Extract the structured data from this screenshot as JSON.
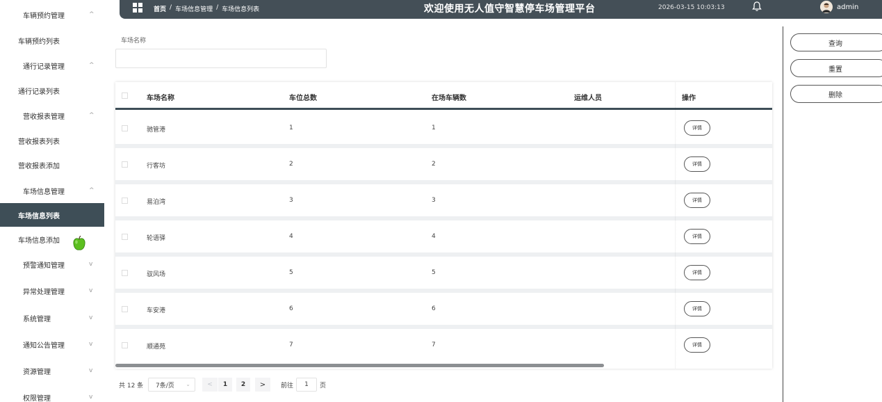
{
  "sidebar": {
    "groups": [
      {
        "label": "车辆预约管理",
        "chevron": "^"
      },
      {
        "label": "通行记录管理",
        "chevron": "^"
      },
      {
        "label": "营收报表管理",
        "chevron": "^"
      },
      {
        "label": "车场信息管理",
        "chevron": "^"
      },
      {
        "label": "预警通知管理",
        "chevron": "v"
      },
      {
        "label": "异常处理管理",
        "chevron": "v"
      },
      {
        "label": "系统管理",
        "chevron": "v"
      },
      {
        "label": "通知公告管理",
        "chevron": "v"
      },
      {
        "label": "资源管理",
        "chevron": "v"
      },
      {
        "label": "权限管理",
        "chevron": "v"
      }
    ],
    "items": [
      {
        "label": "车辆预约列表"
      },
      {
        "label": "通行记录列表"
      },
      {
        "label": "营收报表列表"
      },
      {
        "label": "营收报表添加"
      },
      {
        "label": "车场信息列表",
        "active": true
      },
      {
        "label": "车场信息添加"
      }
    ]
  },
  "header": {
    "breadcrumb_home": "首页",
    "breadcrumb_sep": "/",
    "breadcrumb_1": "车场信息管理",
    "breadcrumb_2": "车场信息列表",
    "title": "欢迎使用无人值守智慧停车场管理平台",
    "datetime": "2026-03-15 10:03:13",
    "username": "admin"
  },
  "search": {
    "label": "车场名称",
    "value": "",
    "placeholder": ""
  },
  "actions": {
    "query": "查询",
    "reset": "重置",
    "delete": "删除"
  },
  "table": {
    "columns": [
      "车场名称",
      "车位总数",
      "在场车辆数",
      "运维人员",
      "操作"
    ],
    "detail_label": "详情",
    "rows": [
      {
        "name": "驰管港",
        "total": "1",
        "present": "1",
        "staff": ""
      },
      {
        "name": "行客坊",
        "total": "2",
        "present": "2",
        "staff": ""
      },
      {
        "name": "易泊湾",
        "total": "3",
        "present": "3",
        "staff": ""
      },
      {
        "name": "轮语驿",
        "total": "4",
        "present": "4",
        "staff": ""
      },
      {
        "name": "驭风场",
        "total": "5",
        "present": "5",
        "staff": ""
      },
      {
        "name": "车安港",
        "total": "6",
        "present": "6",
        "staff": ""
      },
      {
        "name": "顺通苑",
        "total": "7",
        "present": "7",
        "staff": ""
      }
    ]
  },
  "pagination": {
    "total": "共 12 条",
    "page_size": "7条/页",
    "prev": "<",
    "pages": [
      "1",
      "2"
    ],
    "current": "1",
    "next": ">",
    "goto_label": "前往",
    "goto_value": "1",
    "goto_suffix": "页"
  },
  "colors": {
    "header_bg": "#444f57",
    "sidebar_active_bg": "#3e4e57",
    "table_header_border": "#3e4e57"
  }
}
